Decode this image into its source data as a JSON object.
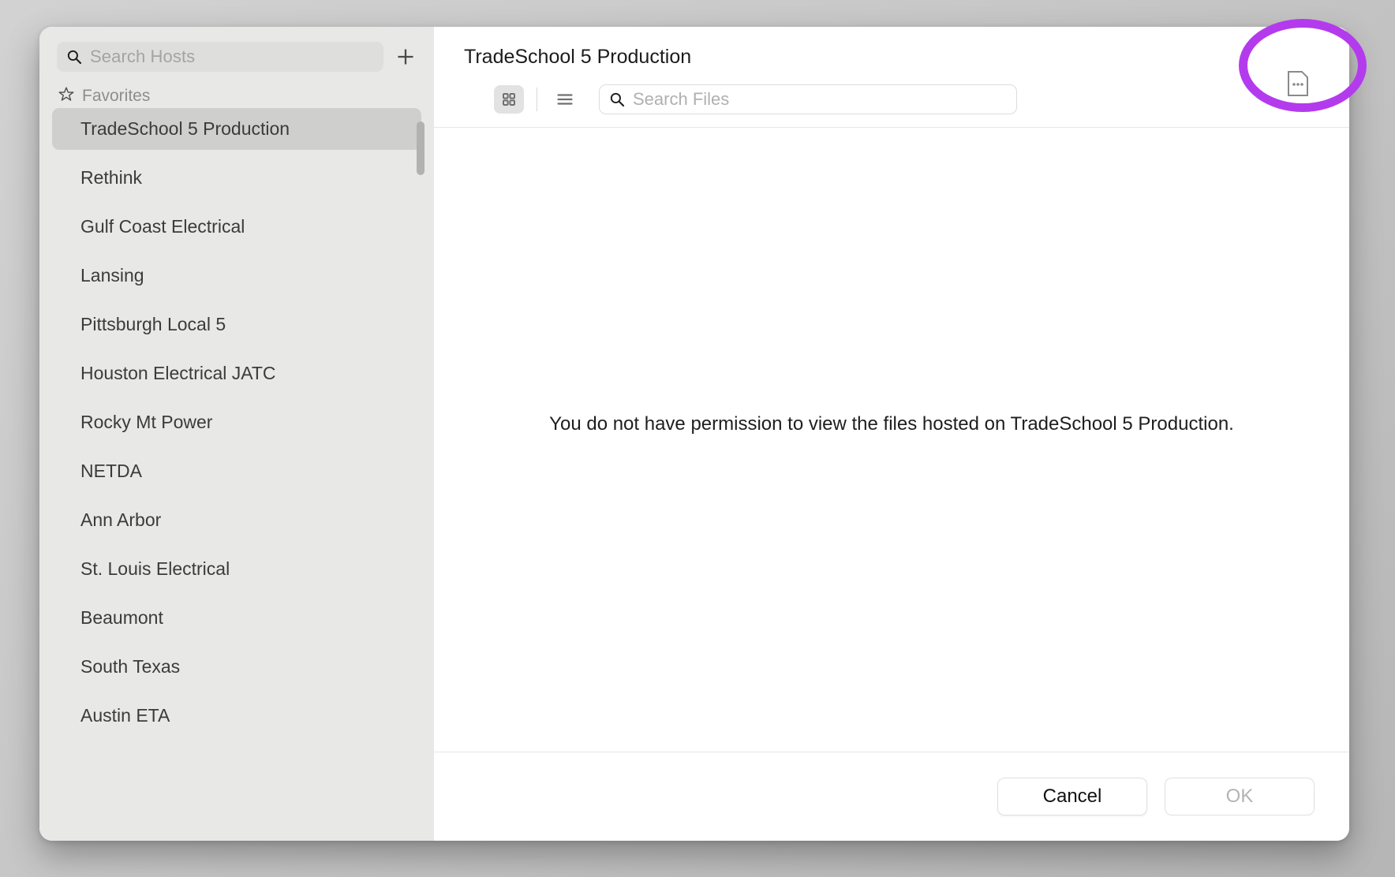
{
  "sidebar": {
    "search": {
      "placeholder": "Search Hosts",
      "icon": "search-icon"
    },
    "add_button_icon": "plus-icon",
    "section_label": "Favorites",
    "section_icon": "star-icon",
    "items": [
      {
        "label": "TradeSchool 5 Production",
        "selected": true
      },
      {
        "label": "Rethink",
        "selected": false
      },
      {
        "label": "Gulf Coast Electrical",
        "selected": false
      },
      {
        "label": "Lansing",
        "selected": false
      },
      {
        "label": "Pittsburgh Local 5",
        "selected": false
      },
      {
        "label": "Houston Electrical JATC",
        "selected": false
      },
      {
        "label": "Rocky Mt Power",
        "selected": false
      },
      {
        "label": "NETDA",
        "selected": false
      },
      {
        "label": "Ann Arbor",
        "selected": false
      },
      {
        "label": "St. Louis Electrical",
        "selected": false
      },
      {
        "label": "Beaumont",
        "selected": false
      },
      {
        "label": "South Texas",
        "selected": false
      },
      {
        "label": "Austin ETA",
        "selected": false
      }
    ]
  },
  "main": {
    "title": "TradeSchool 5 Production",
    "toolbar": {
      "grid_view_icon": "grid-view-icon",
      "list_view_icon": "list-view-icon",
      "search_placeholder": "Search Files",
      "search_icon": "search-icon",
      "menu_icon": "document-ellipsis-icon"
    },
    "empty_message": "You do not have permission to view the files hosted on TradeSchool 5 Production."
  },
  "footer": {
    "cancel_label": "Cancel",
    "ok_label": "OK"
  },
  "annotation": {
    "highlight_color": "#b43bed",
    "target": "document-ellipsis-icon"
  }
}
